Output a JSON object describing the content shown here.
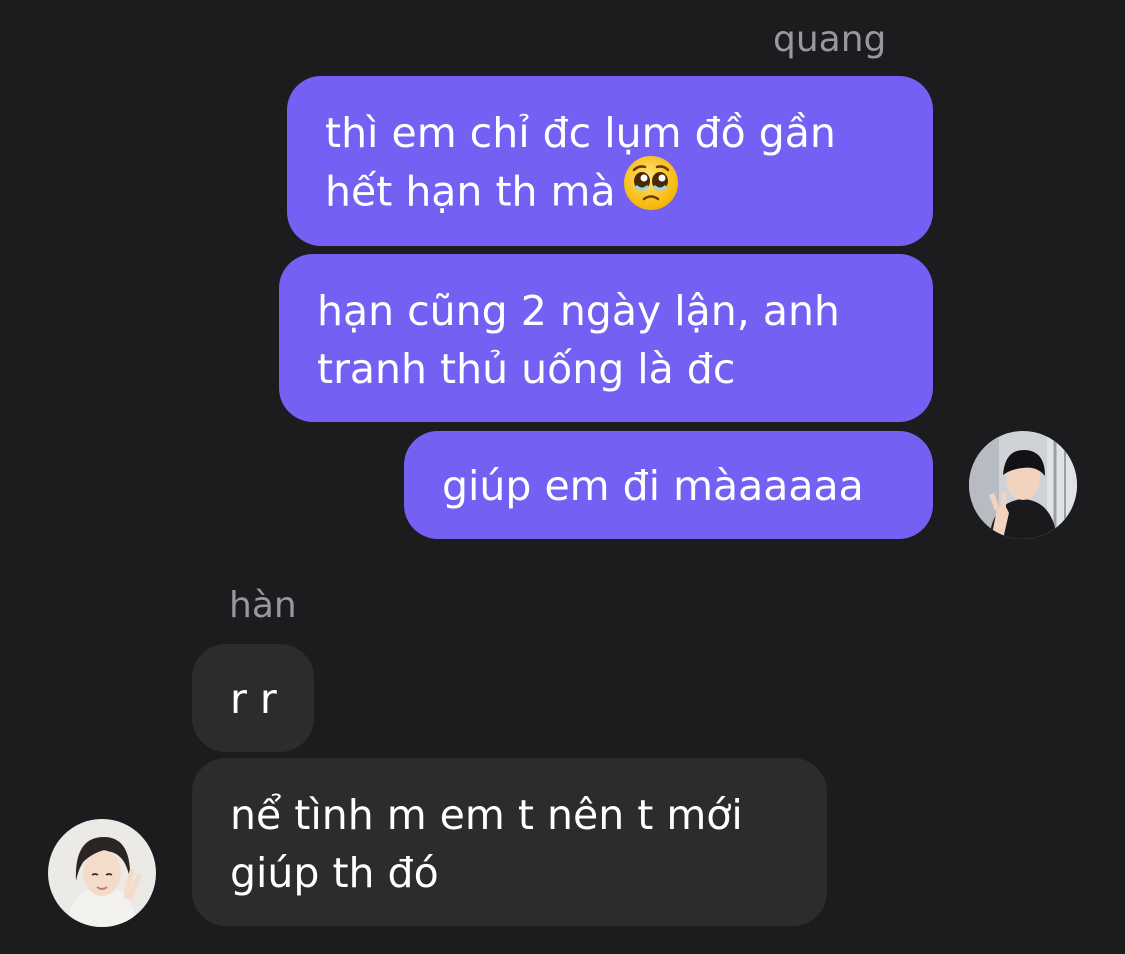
{
  "conversation": {
    "outgoing_sender": "quang",
    "incoming_sender": "hàn",
    "messages": [
      {
        "from": "quang",
        "line1": "thì em chỉ đc lụm đồ gần",
        "line2": "hết hạn th mà",
        "emoji": "pleading-face-icon"
      },
      {
        "from": "quang",
        "line1": "hạn cũng 2 ngày lận, anh",
        "line2": "tranh thủ uống là đc"
      },
      {
        "from": "quang",
        "line1": "giúp em đi màaaaaa"
      },
      {
        "from": "hàn",
        "line1": "r r"
      },
      {
        "from": "hàn",
        "line1": "nể tình m em t nên t mới",
        "line2": "giúp th đó"
      }
    ]
  },
  "colors": {
    "background": "#1c1c1e",
    "outgoing_bubble": "#7560f4",
    "incoming_bubble": "#2c2c2e",
    "sender_name": "#98989d"
  }
}
